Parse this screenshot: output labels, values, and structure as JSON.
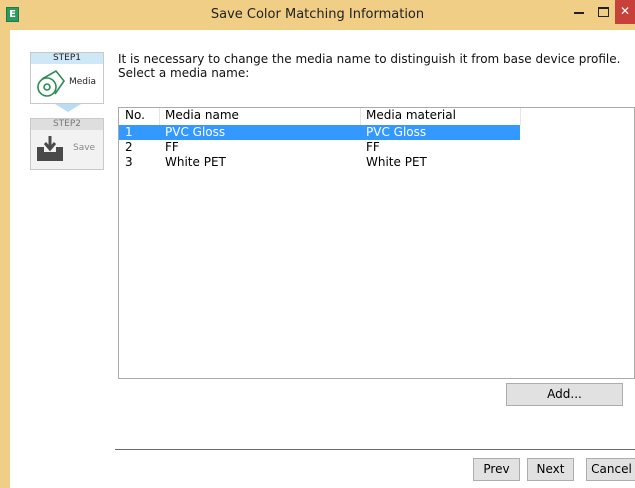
{
  "window": {
    "title": "Save Color Matching Information",
    "app_icon_letter": "E",
    "close_glyph": "✕"
  },
  "steps": [
    {
      "header": "STEP1",
      "label": "Media",
      "icon": "media-roll-icon",
      "active": true
    },
    {
      "header": "STEP2",
      "label": "Save",
      "icon": "save-tray-icon",
      "active": false
    }
  ],
  "instructions": {
    "line1": "It is necessary to change the media name to distinguish it from base device profile.",
    "line2": "Select a media name:"
  },
  "table": {
    "columns": [
      "No.",
      "Media name",
      "Media material"
    ],
    "rows": [
      {
        "no": "1",
        "name": "PVC Gloss",
        "material": "PVC Gloss",
        "selected": true
      },
      {
        "no": "2",
        "name": "FF",
        "material": "FF",
        "selected": false
      },
      {
        "no": "3",
        "name": "White PET",
        "material": "White PET",
        "selected": false
      }
    ]
  },
  "buttons": {
    "add": "Add...",
    "prev": "Prev",
    "next": "Next",
    "cancel": "Cancel"
  },
  "colors": {
    "titlebar": "#f0ce85",
    "selection": "#3399ff",
    "close": "#c7403a"
  }
}
